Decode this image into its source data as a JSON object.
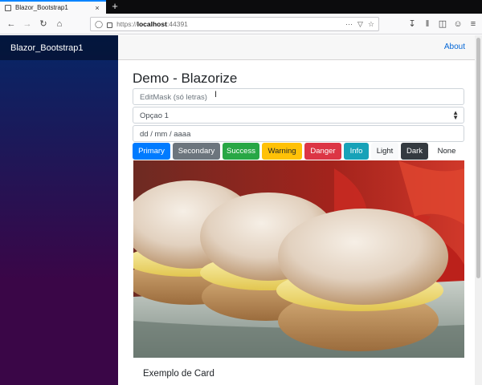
{
  "browser": {
    "tab_title": "Blazor_Bootstrap1",
    "tab_close": "×",
    "new_tab": "+",
    "url": {
      "protocol": "https://",
      "host": "localhost",
      "port": ":44391"
    }
  },
  "sidebar": {
    "brand": "Blazor_Bootstrap1"
  },
  "topbar": {
    "about": "About"
  },
  "main": {
    "title": "Demo - Blazorize",
    "edit_mask_placeholder": "EditMask (só letras)",
    "select_value": "Opçao 1",
    "date_placeholder": "dd / mm / aaaa",
    "buttons": [
      "Primary",
      "Secondary",
      "Success",
      "Warning",
      "Danger",
      "Info",
      "Light",
      "Dark",
      "None"
    ],
    "card_title": "Exemplo de Card"
  },
  "colors": {
    "primary": "#007bff",
    "secondary": "#6c757d",
    "success": "#28a745",
    "warning": "#ffc107",
    "danger": "#dc3545",
    "info": "#17a2b8",
    "light": "#f8f9fa",
    "dark": "#343a40",
    "link": "#0366d6"
  },
  "icons": [
    "back-arrow-icon",
    "forward-arrow-icon",
    "reload-icon",
    "home-icon",
    "shield-icon",
    "lock-icon",
    "pocket-icon",
    "bookmark-star-icon",
    "download-icon",
    "library-icon",
    "sidebar-toggle-icon",
    "account-icon",
    "menu-icon",
    "text-cursor-icon"
  ]
}
